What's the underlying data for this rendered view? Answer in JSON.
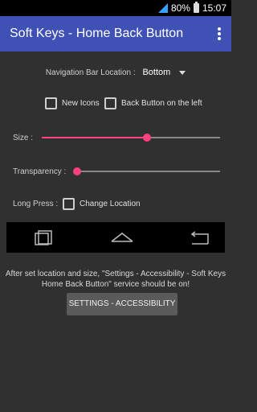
{
  "status_bar": {
    "battery": "80%",
    "time": "15:07"
  },
  "app_bar": {
    "title": "Soft Keys - Home Back Button",
    "menu_icon": "overflow-menu-icon"
  },
  "navigation": {
    "label": "Navigation Bar Location :",
    "value": "Bottom"
  },
  "options": {
    "new_icons": {
      "label": "New Icons",
      "checked": false
    },
    "back_left": {
      "label": "Back Button on the left",
      "checked": false
    }
  },
  "size": {
    "label": "Size :",
    "value_fraction": 0.59
  },
  "transparency": {
    "label": "Transparency :",
    "value_fraction": 0.0
  },
  "long_press": {
    "label": "Long Press :",
    "option": {
      "label": "Change Location",
      "checked": false
    }
  },
  "preview_icons": [
    "recent-apps-icon",
    "home-icon",
    "back-icon"
  ],
  "info": {
    "line1": "After set location and size, \"Settings - Accessibility - Soft Keys",
    "line2": "Home Back Button\" service should be on!"
  },
  "button": {
    "label": "SETTINGS - ACCESSIBILITY"
  }
}
